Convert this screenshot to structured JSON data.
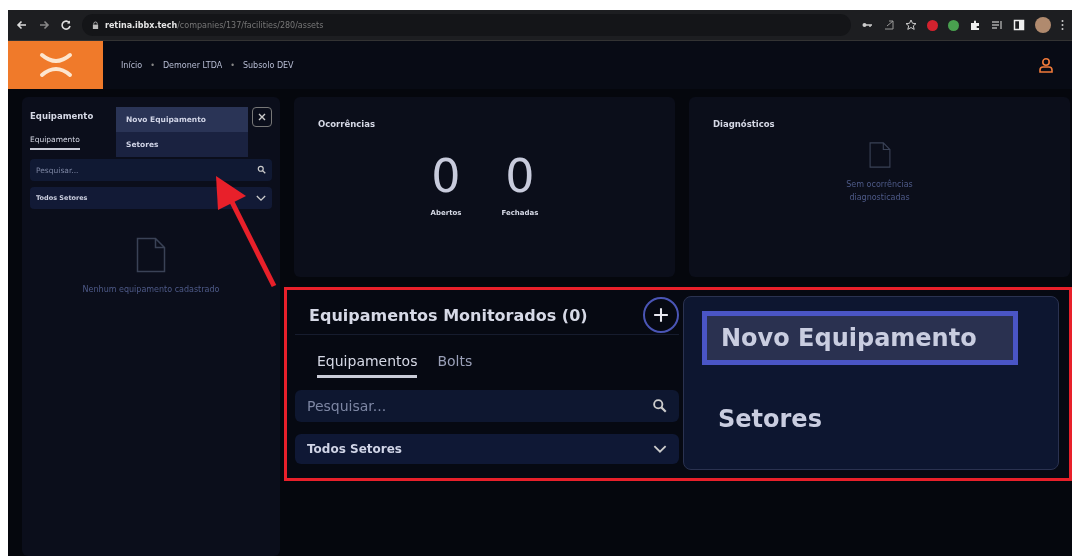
{
  "browser": {
    "url_host": "retina.ibbx.tech",
    "url_path": "/companies/137/facilities/280/assets"
  },
  "header": {
    "breadcrumbs": [
      "Início",
      "Demoner LTDA",
      "Subsolo DEV"
    ],
    "separator": "•"
  },
  "sidebar": {
    "title": "Equipamento",
    "tabs": [
      {
        "label": "Equipamento",
        "selected": true
      }
    ],
    "search": {
      "placeholder": "Pesquisar..."
    },
    "sector_select": "Todos Setores",
    "empty_text": "Nenhum equipamento cadastrado",
    "menu": [
      {
        "label": "Novo Equipamento",
        "selected": true
      },
      {
        "label": "Setores",
        "selected": false
      }
    ]
  },
  "occurrences": {
    "title": "Ocorrências",
    "stats": [
      {
        "value": "0",
        "label": "Abertos"
      },
      {
        "value": "0",
        "label": "Fechadas"
      }
    ]
  },
  "diagnostics": {
    "title": "Diagnósticos",
    "empty_text": "Sem ocorrências diagnosticadas"
  },
  "callout": {
    "title": "Equipamentos Monitorados (0)",
    "tabs": [
      {
        "label": "Equipamentos",
        "selected": true
      },
      {
        "label": "Bolts",
        "selected": false
      }
    ],
    "search": {
      "placeholder": "Pesquisar..."
    },
    "sector_select": "Todos Setores",
    "menu": [
      {
        "label": "Novo Equipamento",
        "selected": true
      },
      {
        "label": "Setores",
        "selected": false
      }
    ]
  }
}
